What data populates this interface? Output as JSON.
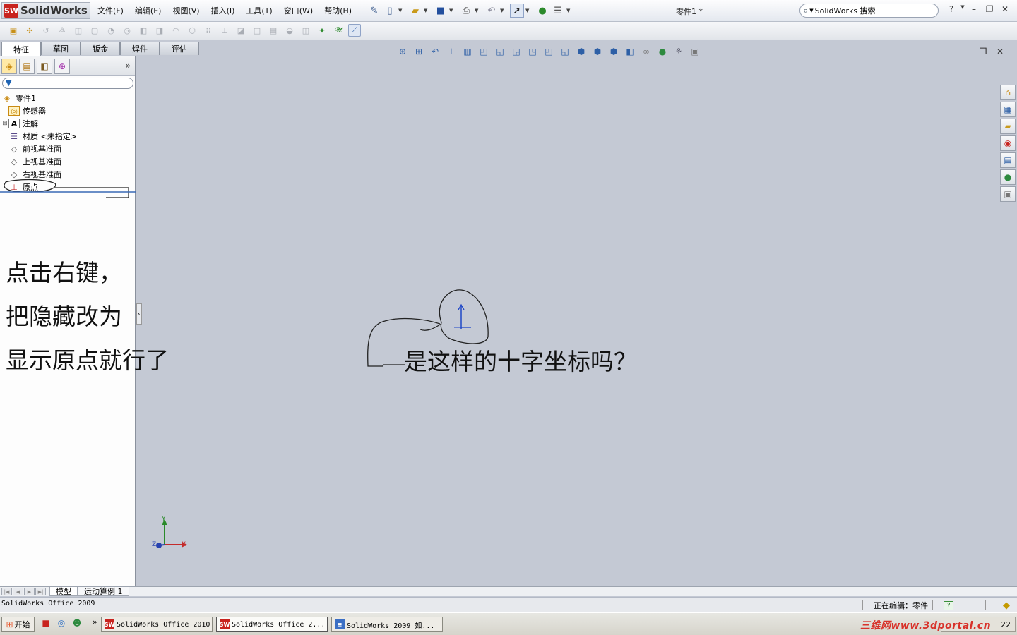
{
  "app": {
    "logo_text": "SolidWorks",
    "doc_title": "零件1 *",
    "search_placeholder": "SolidWorks 搜索"
  },
  "menu": [
    "文件(F)",
    "编辑(E)",
    "视图(V)",
    "插入(I)",
    "工具(T)",
    "窗口(W)",
    "帮助(H)"
  ],
  "tabs": [
    "特征",
    "草图",
    "钣金",
    "焊件",
    "评估"
  ],
  "selected_tab": "特征",
  "feature_tree": {
    "root": "零件1",
    "items": [
      {
        "label": "传感器",
        "icon": "sensor-icon",
        "expandable": false
      },
      {
        "label": "注解",
        "icon": "annotation-icon",
        "expandable": true
      },
      {
        "label": "材质 <未指定>",
        "icon": "material-icon",
        "expandable": false
      },
      {
        "label": "前视基准面",
        "icon": "plane-icon",
        "expandable": false
      },
      {
        "label": "上视基准面",
        "icon": "plane-icon",
        "expandable": false
      },
      {
        "label": "右视基准面",
        "icon": "plane-icon",
        "expandable": false
      },
      {
        "label": "原点",
        "icon": "origin-icon",
        "expandable": false
      }
    ]
  },
  "annotations": {
    "left_lines": [
      "点击右键，",
      "把隐藏改为",
      "显示原点就行了"
    ],
    "main": "是这样的十字坐标吗？"
  },
  "triad": {
    "y": "Y",
    "x": "X",
    "z": "Z"
  },
  "bottom_tabs": [
    "模型",
    "运动算例 1"
  ],
  "status": {
    "left": "SolidWorks Office 2009",
    "editing": "正在编辑：零件",
    "help": "?"
  },
  "taskbar": {
    "start": "开始",
    "tasks": [
      "SolidWorks Office 2010",
      "SolidWorks Office 2...",
      "SolidWorks 2009 如..."
    ],
    "clock": "22",
    "more": "»"
  },
  "watermark": "三维网www.3dportal.cn",
  "colors": {
    "viewport_bg": "#c4c9d4",
    "brand_red": "#c8231e",
    "origin_blue": "#1f47c7"
  }
}
